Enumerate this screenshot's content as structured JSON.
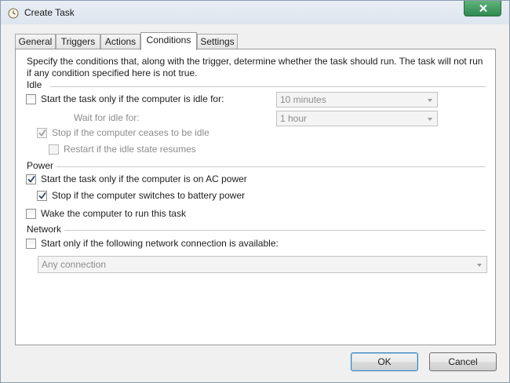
{
  "window": {
    "title": "Create Task",
    "icons": {
      "app": "task-scheduler-clock-icon",
      "close": "close-icon"
    },
    "colors": {
      "close_button": "#3a9a5a",
      "default_button_border": "#3c7fb1"
    }
  },
  "tabs": [
    {
      "label": "General",
      "active": false
    },
    {
      "label": "Triggers",
      "active": false
    },
    {
      "label": "Actions",
      "active": false
    },
    {
      "label": "Conditions",
      "active": true
    },
    {
      "label": "Settings",
      "active": false
    }
  ],
  "conditions": {
    "intro": "Specify the conditions that, along with the trigger, determine whether the task should run.  The task will not run  if any condition specified here is not true.",
    "idle": {
      "heading": "Idle",
      "start_if_idle": {
        "label": "Start the task only if the computer is idle for:",
        "checked": false,
        "enabled": true
      },
      "idle_duration": {
        "value": "10 minutes",
        "enabled": false
      },
      "wait_label": "Wait for idle for:",
      "wait_duration": {
        "value": "1 hour",
        "enabled": false
      },
      "stop_if_not_idle": {
        "label": "Stop if the computer ceases to be idle",
        "checked": true,
        "enabled": false
      },
      "restart_if_idle": {
        "label": "Restart if the idle state resumes",
        "checked": false,
        "enabled": false
      }
    },
    "power": {
      "heading": "Power",
      "ac_power": {
        "label": "Start the task only if the computer is on AC power",
        "checked": true,
        "enabled": true
      },
      "stop_on_battery": {
        "label": "Stop if the computer switches to battery power",
        "checked": true,
        "enabled": true
      },
      "wake_to_run": {
        "label": "Wake the computer to run this task",
        "checked": false,
        "enabled": true
      }
    },
    "network": {
      "heading": "Network",
      "require_network": {
        "label": "Start only if the following network connection is available:",
        "checked": false,
        "enabled": true
      },
      "connection": {
        "value": "Any connection",
        "enabled": false
      }
    }
  },
  "buttons": {
    "ok": "OK",
    "cancel": "Cancel"
  }
}
